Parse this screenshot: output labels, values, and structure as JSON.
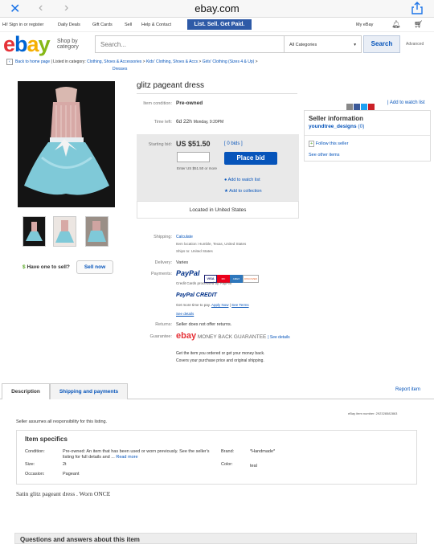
{
  "browser": {
    "url_title": "ebay.com"
  },
  "topnav": {
    "greeting": "Hi! Sign in or register",
    "links": [
      "Daily Deals",
      "Gift Cards",
      "Sell",
      "Help & Contact"
    ],
    "banner": "List. Sell. Get Paid.",
    "my_ebay": "My eBay"
  },
  "header": {
    "logo": [
      "e",
      "b",
      "a",
      "y"
    ],
    "shop_by": "Shop by category",
    "search_placeholder": "Search...",
    "category": "All Categories",
    "search_btn": "Search",
    "advanced": "Advanced"
  },
  "breadcrumb": {
    "back": "Back to home page",
    "listed": "| Listed in category:",
    "path": [
      "Clothing, Shoes & Accessories",
      "Kids' Clothing, Shoes & Accs",
      "Girls' Clothing (Sizes 4 & Up)",
      "Dresses"
    ]
  },
  "item": {
    "title": "glitz pageant dress",
    "condition_label": "Item condition:",
    "condition": "Pre-owned",
    "time_left_label": "Time left:",
    "time_left": "6d 22h",
    "time_left_detail": "Monday, 9:20PM",
    "starting_bid_label": "Starting bid:",
    "starting_bid": "US $51.50",
    "bids": "[ 0 bids ]",
    "place_bid": "Place bid",
    "enter_hint": "Enter US $51.50 or more",
    "watch": "Add to watch list",
    "collection": "Add to collection",
    "located": "Located in United States"
  },
  "seller": {
    "heading": "Seller information",
    "name": "youndtree_designs",
    "feedback": "(0)",
    "follow": "Follow this seller",
    "other_items": "See other items",
    "add_watch": "| Add to watch list"
  },
  "sell_one": {
    "text": "Have one to sell?",
    "button": "Sell now"
  },
  "shipping": {
    "label": "Shipping:",
    "calculate": "Calculate",
    "location": "Item location: Humble, Texas, United States",
    "ships_to": "Ships to: United States"
  },
  "delivery": {
    "label": "Delivery:",
    "value": "Varies"
  },
  "payments": {
    "label": "Payments:",
    "paypal": "PayPal",
    "cards": [
      "VISA",
      "MC",
      "AMEX",
      "DISCOVER"
    ],
    "processed": "Credit Cards processed by PayPal",
    "credit": "PayPal CREDIT",
    "credit_text": "Get more time to pay.",
    "apply": "Apply Now",
    "terms": "See Terms",
    "details": "See details"
  },
  "returns": {
    "label": "Returns:",
    "value": "Seller does not offer returns."
  },
  "guarantee": {
    "label": "Guarantee:",
    "brand": "ebay",
    "text": "MONEY BACK GUARANTEE",
    "see": "| See details",
    "line1": "Get the item you ordered or get your money back.",
    "line2": "Covers your purchase price and original shipping."
  },
  "tabs": [
    "Description",
    "Shipping and payments"
  ],
  "report": "Report item",
  "item_number": "eBay item number:  292328582863",
  "responsibility": "Seller assumes all responsibility for this listing.",
  "specs": {
    "heading": "Item specifics",
    "condition_label": "Condition:",
    "condition": "Pre-owned: An item that has been used or worn previously. See the seller's listing for full details and ...",
    "read_more": "Read more",
    "size_label": "Size:",
    "size": "2t",
    "occasion_label": "Occasion:",
    "occasion": "Pageant",
    "brand_label": "Brand:",
    "brand": "*Handmade*",
    "color_label": "Color:",
    "color": "teal"
  },
  "description": "Satin glitz pageant dress . Worn ONCE",
  "qna": "Questions and answers about this item",
  "colors": {
    "link": "#0654ba",
    "banner": "#2e5aa7"
  }
}
